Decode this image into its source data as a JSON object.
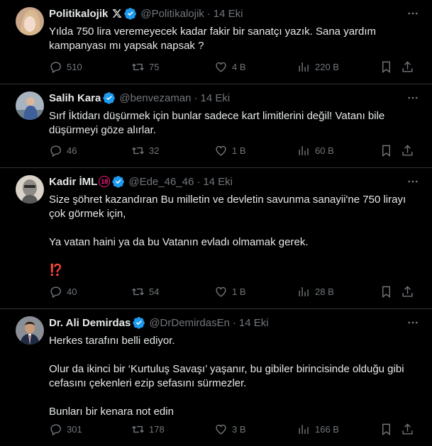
{
  "tweets": [
    {
      "name": "Politikalojik",
      "handle": "@Politikalojik",
      "time": "14 Eki",
      "text": [
        "Yılda 750 lira veremeyecek kadar fakir bir sanatçı yazık. Sana yardım kampanyası mı yapsak napsak ?"
      ],
      "replies": "510",
      "reposts": "75",
      "likes": "4 B",
      "views": "220 B"
    },
    {
      "name": "Salih Kara",
      "handle": "@benvezaman",
      "time": "14 Eki",
      "text": [
        "Sırf İktidarı düşürmek için bunlar sadece kart limitlerini değil! Vatanı bile düşürmeyi göze alırlar."
      ],
      "replies": "46",
      "reposts": "32",
      "likes": "1 B",
      "views": "60 B"
    },
    {
      "name": "Kadir İML",
      "name_badge": "18",
      "handle": "@Ede_46_46",
      "time": "14 Eki",
      "text": [
        "Size şöhret kazandıran Bu milletin ve devletin savunma sanayii'ne 750 lirayı çok görmek için,",
        "",
        "Ya vatan haini ya da bu Vatanın evladı olmamak gerek.",
        "",
        "⁉️"
      ],
      "replies": "40",
      "reposts": "54",
      "likes": "1 B",
      "views": "28 B"
    },
    {
      "name": "Dr. Ali Demirdas",
      "handle": "@DrDemirdasEn",
      "time": "14 Eki",
      "text": [
        "Herkes tarafını belli ediyor.",
        "",
        "Olur da ikinci bir ‘Kurtuluş Savaşı’ yaşanır, bu gibiler birincisinde olduğu gibi cefasını çekenleri ezip sefasını sürmezler.",
        "",
        "Bunları bir kenara not edin"
      ],
      "replies": "301",
      "reposts": "178",
      "likes": "3 B",
      "views": "166 B"
    }
  ],
  "colors": {
    "background": "#000000",
    "verified": "#1d9bf0",
    "muted": "#71767b",
    "text": "#e7e9ea",
    "divider": "#2f3336"
  },
  "icons": [
    "x-logo-icon",
    "verified-badge-icon",
    "more-icon",
    "reply-icon",
    "repost-icon",
    "like-icon",
    "views-icon",
    "bookmark-icon",
    "share-icon"
  ]
}
